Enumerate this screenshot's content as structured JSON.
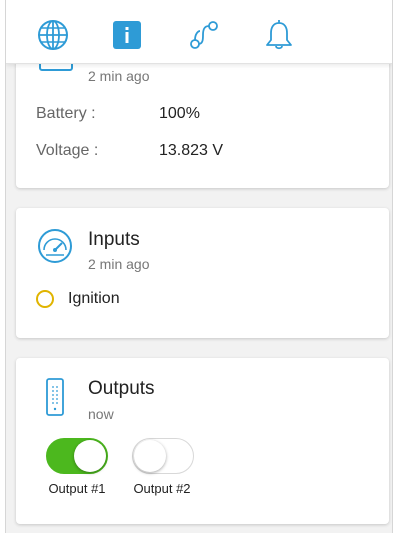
{
  "accent_color": "#2e9bd6",
  "tabs": [
    {
      "icon": "globe-icon",
      "active": false
    },
    {
      "icon": "info-icon",
      "active": true
    },
    {
      "icon": "route-icon",
      "active": false
    },
    {
      "icon": "bell-icon",
      "active": false
    }
  ],
  "power_card": {
    "icon": "battery-icon",
    "time": "2 min ago",
    "rows": [
      {
        "label": "Battery :",
        "value": "100%"
      },
      {
        "label": "Voltage :",
        "value": "13.823 V"
      }
    ]
  },
  "inputs_card": {
    "icon": "gauge-icon",
    "title": "Inputs",
    "time": "2 min ago",
    "items": [
      {
        "label": "Ignition",
        "status_color": "#e0b400"
      }
    ]
  },
  "outputs_card": {
    "icon": "remote-icon",
    "title": "Outputs",
    "time": "now",
    "toggles": [
      {
        "label": "Output #1",
        "on": true
      },
      {
        "label": "Output #2",
        "on": false
      }
    ],
    "on_color": "#4cb81e"
  }
}
